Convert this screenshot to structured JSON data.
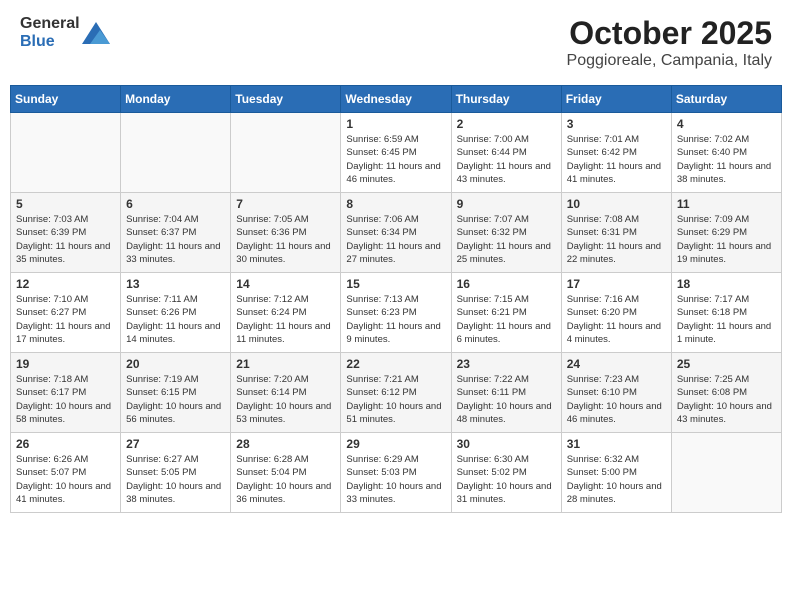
{
  "header": {
    "logo_general": "General",
    "logo_blue": "Blue",
    "month": "October 2025",
    "location": "Poggioreale, Campania, Italy"
  },
  "calendar": {
    "days_of_week": [
      "Sunday",
      "Monday",
      "Tuesday",
      "Wednesday",
      "Thursday",
      "Friday",
      "Saturday"
    ],
    "weeks": [
      [
        {
          "day": "",
          "info": ""
        },
        {
          "day": "",
          "info": ""
        },
        {
          "day": "",
          "info": ""
        },
        {
          "day": "1",
          "info": "Sunrise: 6:59 AM\nSunset: 6:45 PM\nDaylight: 11 hours and 46 minutes."
        },
        {
          "day": "2",
          "info": "Sunrise: 7:00 AM\nSunset: 6:44 PM\nDaylight: 11 hours and 43 minutes."
        },
        {
          "day": "3",
          "info": "Sunrise: 7:01 AM\nSunset: 6:42 PM\nDaylight: 11 hours and 41 minutes."
        },
        {
          "day": "4",
          "info": "Sunrise: 7:02 AM\nSunset: 6:40 PM\nDaylight: 11 hours and 38 minutes."
        }
      ],
      [
        {
          "day": "5",
          "info": "Sunrise: 7:03 AM\nSunset: 6:39 PM\nDaylight: 11 hours and 35 minutes."
        },
        {
          "day": "6",
          "info": "Sunrise: 7:04 AM\nSunset: 6:37 PM\nDaylight: 11 hours and 33 minutes."
        },
        {
          "day": "7",
          "info": "Sunrise: 7:05 AM\nSunset: 6:36 PM\nDaylight: 11 hours and 30 minutes."
        },
        {
          "day": "8",
          "info": "Sunrise: 7:06 AM\nSunset: 6:34 PM\nDaylight: 11 hours and 27 minutes."
        },
        {
          "day": "9",
          "info": "Sunrise: 7:07 AM\nSunset: 6:32 PM\nDaylight: 11 hours and 25 minutes."
        },
        {
          "day": "10",
          "info": "Sunrise: 7:08 AM\nSunset: 6:31 PM\nDaylight: 11 hours and 22 minutes."
        },
        {
          "day": "11",
          "info": "Sunrise: 7:09 AM\nSunset: 6:29 PM\nDaylight: 11 hours and 19 minutes."
        }
      ],
      [
        {
          "day": "12",
          "info": "Sunrise: 7:10 AM\nSunset: 6:27 PM\nDaylight: 11 hours and 17 minutes."
        },
        {
          "day": "13",
          "info": "Sunrise: 7:11 AM\nSunset: 6:26 PM\nDaylight: 11 hours and 14 minutes."
        },
        {
          "day": "14",
          "info": "Sunrise: 7:12 AM\nSunset: 6:24 PM\nDaylight: 11 hours and 11 minutes."
        },
        {
          "day": "15",
          "info": "Sunrise: 7:13 AM\nSunset: 6:23 PM\nDaylight: 11 hours and 9 minutes."
        },
        {
          "day": "16",
          "info": "Sunrise: 7:15 AM\nSunset: 6:21 PM\nDaylight: 11 hours and 6 minutes."
        },
        {
          "day": "17",
          "info": "Sunrise: 7:16 AM\nSunset: 6:20 PM\nDaylight: 11 hours and 4 minutes."
        },
        {
          "day": "18",
          "info": "Sunrise: 7:17 AM\nSunset: 6:18 PM\nDaylight: 11 hours and 1 minute."
        }
      ],
      [
        {
          "day": "19",
          "info": "Sunrise: 7:18 AM\nSunset: 6:17 PM\nDaylight: 10 hours and 58 minutes."
        },
        {
          "day": "20",
          "info": "Sunrise: 7:19 AM\nSunset: 6:15 PM\nDaylight: 10 hours and 56 minutes."
        },
        {
          "day": "21",
          "info": "Sunrise: 7:20 AM\nSunset: 6:14 PM\nDaylight: 10 hours and 53 minutes."
        },
        {
          "day": "22",
          "info": "Sunrise: 7:21 AM\nSunset: 6:12 PM\nDaylight: 10 hours and 51 minutes."
        },
        {
          "day": "23",
          "info": "Sunrise: 7:22 AM\nSunset: 6:11 PM\nDaylight: 10 hours and 48 minutes."
        },
        {
          "day": "24",
          "info": "Sunrise: 7:23 AM\nSunset: 6:10 PM\nDaylight: 10 hours and 46 minutes."
        },
        {
          "day": "25",
          "info": "Sunrise: 7:25 AM\nSunset: 6:08 PM\nDaylight: 10 hours and 43 minutes."
        }
      ],
      [
        {
          "day": "26",
          "info": "Sunrise: 6:26 AM\nSunset: 5:07 PM\nDaylight: 10 hours and 41 minutes."
        },
        {
          "day": "27",
          "info": "Sunrise: 6:27 AM\nSunset: 5:05 PM\nDaylight: 10 hours and 38 minutes."
        },
        {
          "day": "28",
          "info": "Sunrise: 6:28 AM\nSunset: 5:04 PM\nDaylight: 10 hours and 36 minutes."
        },
        {
          "day": "29",
          "info": "Sunrise: 6:29 AM\nSunset: 5:03 PM\nDaylight: 10 hours and 33 minutes."
        },
        {
          "day": "30",
          "info": "Sunrise: 6:30 AM\nSunset: 5:02 PM\nDaylight: 10 hours and 31 minutes."
        },
        {
          "day": "31",
          "info": "Sunrise: 6:32 AM\nSunset: 5:00 PM\nDaylight: 10 hours and 28 minutes."
        },
        {
          "day": "",
          "info": ""
        }
      ]
    ]
  }
}
